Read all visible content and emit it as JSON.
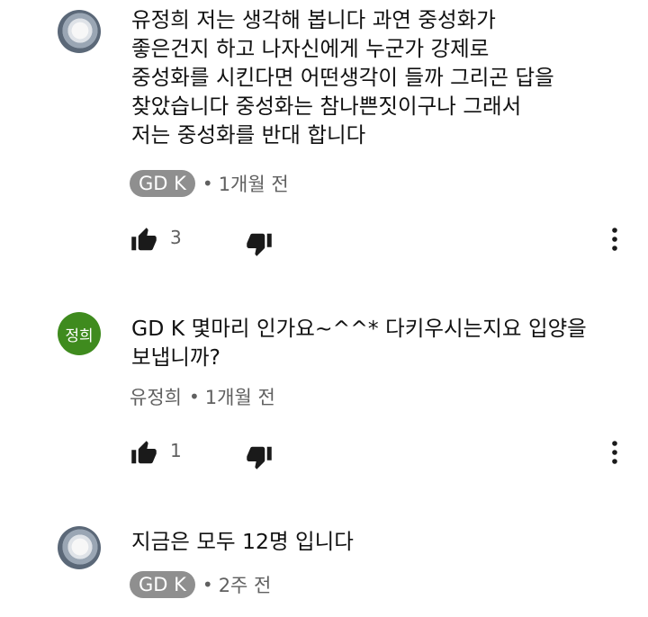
{
  "comments": [
    {
      "author": "유정희",
      "text": "유정희 저는 생각해 봅니다 과연 중성화가\n좋은건지 하고 나자신에게 누군가 강제로\n중성화를 시킨다면 어떤생각이 들까 그리곤 답을\n찾았습니다 중성화는 참나쁜짓이구나 그래서\n저는 중성화를 반대 합니다",
      "reply_to": "GD K",
      "time": "1개월 전",
      "likes": "3"
    },
    {
      "author": "유정희",
      "avatar_text": "정희",
      "avatar_color": "#3f8b1e",
      "text": "GD K 몇마리 인가요~^^* 다키우시는지요 입양을\n보냅니까?",
      "reply_to": "유정희",
      "time": "1개월 전",
      "likes": "1"
    },
    {
      "author": "GD K",
      "text": "지금은 모두 12명 입니다",
      "reply_to": "GD K",
      "time": "2주 전",
      "likes": ""
    }
  ],
  "meta_separator": "•",
  "icons": {
    "like": "thumbs-up-icon",
    "dislike": "thumbs-down-icon",
    "more": "more-vertical-icon"
  },
  "colors": {
    "chip_bg": "#8f8f8f",
    "secondary_text": "#606060",
    "avatar_green": "#3f8b1e"
  }
}
